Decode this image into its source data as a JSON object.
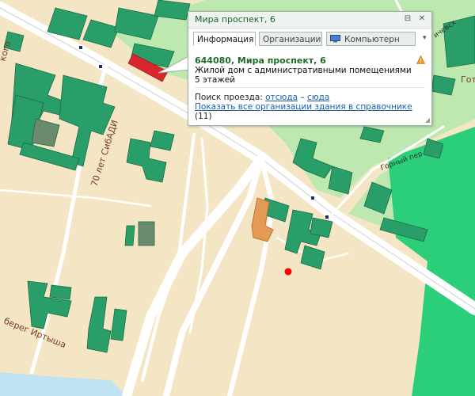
{
  "map": {
    "street_labels": {
      "sibadi": "70 лет СибАДИ",
      "irtysh": "берег Иртыша",
      "gorny": "Горный пер",
      "kogo": "кого",
      "chkovsky": "ичевсх",
      "got": "Гот"
    },
    "colors": {
      "background": "#f4e6c4",
      "park": "#27c476",
      "lightpark": "#bde9b1",
      "building": "#2a9e68",
      "selected_building": "#d8272d",
      "road": "#ffffff",
      "water": "#bfe3f2",
      "marker": "#ff0000"
    }
  },
  "popup": {
    "title": "Мира проспект, 6",
    "pin_icon": "pin-icon",
    "close_icon": "close-icon",
    "tabs": [
      {
        "label": "Информация",
        "active": true
      },
      {
        "label": "Организации",
        "active": false
      },
      {
        "label": "Компьютерн",
        "active": false
      }
    ],
    "address": "644080, Мира проспект, 6",
    "description_line1": "Жилой дом с административными помещениями",
    "description_line2": "5 этажей",
    "route_label": "Поиск проезда:",
    "route_from": "отсюда",
    "route_dash": "–",
    "route_to": "сюда",
    "all_orgs_link": "Показать все организации здания в справочнике",
    "all_orgs_count": "(11)"
  }
}
